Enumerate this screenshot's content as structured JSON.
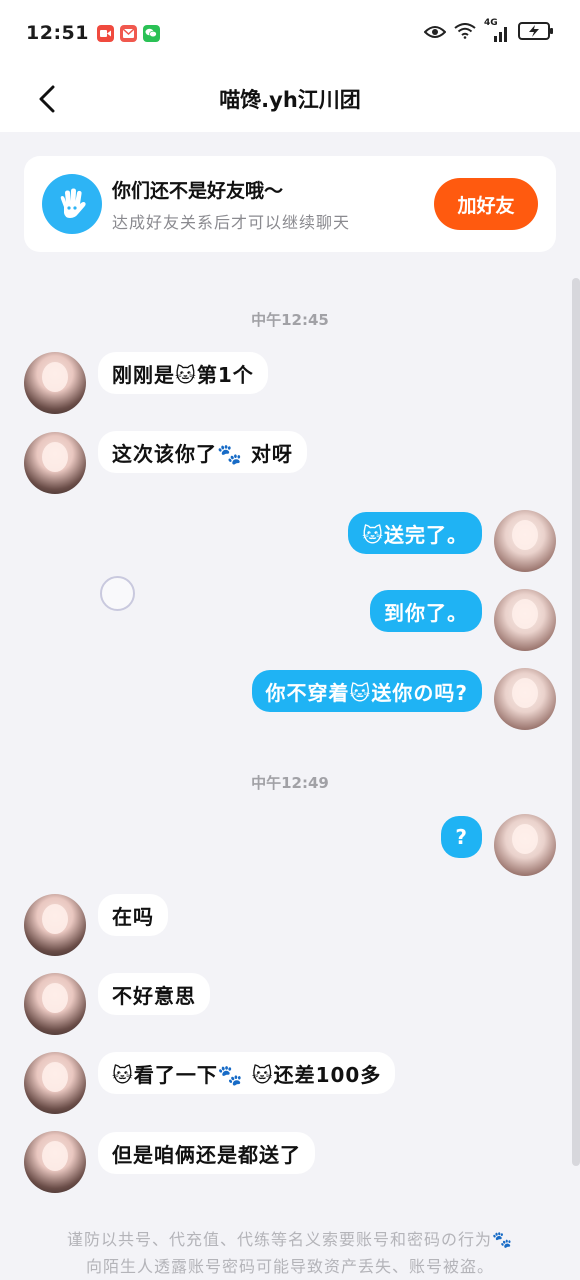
{
  "status_bar": {
    "time": "12:51",
    "app_icons": [
      "video-app-icon",
      "mail-app-icon",
      "wechat-app-icon"
    ],
    "network": "4G"
  },
  "header": {
    "title": "喵馋.yh江川团"
  },
  "friend_card": {
    "title": "你们还不是好友哦～",
    "subtitle": "达成好友关系后才可以继续聊天",
    "button": "加好友"
  },
  "timestamps": [
    "中午12:45",
    "中午12:49"
  ],
  "messages": [
    {
      "side": "left",
      "text": "刚刚是🐱第1个"
    },
    {
      "side": "left",
      "text": "这次该你了🐾 对呀"
    },
    {
      "side": "right",
      "text": "🐱送完了。"
    },
    {
      "side": "right",
      "text": "到你了。"
    },
    {
      "side": "right",
      "text": "你不穿着🐱送你の吗?"
    },
    {
      "side": "right",
      "text": "?"
    },
    {
      "side": "left",
      "text": "在吗"
    },
    {
      "side": "left",
      "text": "不好意思"
    },
    {
      "side": "left",
      "text": "🐱看了一下🐾 🐱还差100多"
    },
    {
      "side": "left",
      "text": "但是咱俩还是都送了"
    }
  ],
  "notice": {
    "line1": "谨防以共号、代充值、代练等名义索要账号和密码の行为🐾",
    "line2": "向陌生人透露账号密码可能导致资产丢失、账号被盗。"
  },
  "colors": {
    "accent_blue": "#1fb3f4",
    "add_button": "#ff5a0f",
    "background": "#f3f3f7"
  }
}
